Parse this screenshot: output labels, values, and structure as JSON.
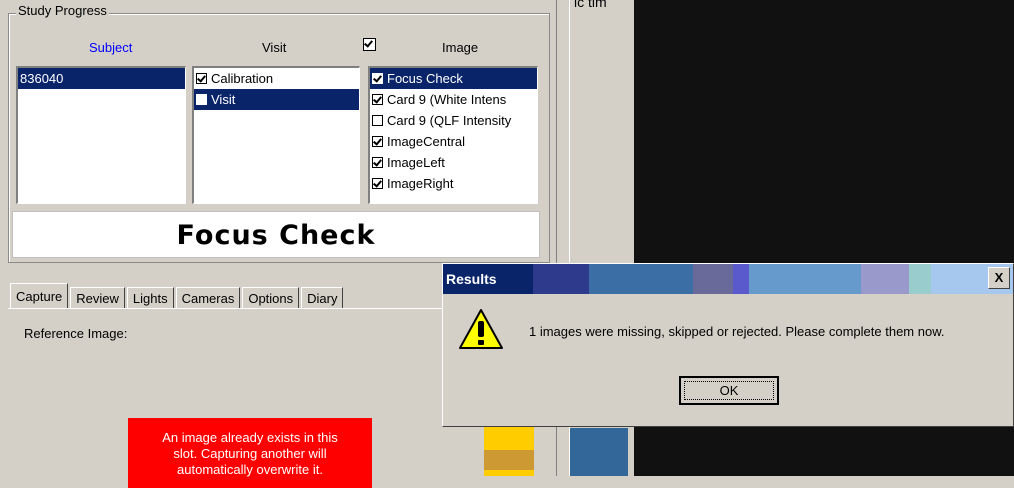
{
  "study_progress": {
    "title": "Study Progress",
    "headers": {
      "subject": "Subject",
      "visit": "Visit",
      "image": "Image"
    },
    "header_checkbox_checked": true,
    "subjects": [
      {
        "label": "836040",
        "selected": true
      }
    ],
    "visits": [
      {
        "label": "Calibration",
        "checked": true,
        "selected": false
      },
      {
        "label": "Visit",
        "checked": false,
        "selected": true
      }
    ],
    "images": [
      {
        "label": "Focus Check",
        "checked": true,
        "selected": true
      },
      {
        "label": "Card 9 (White Intens",
        "checked": true,
        "selected": false
      },
      {
        "label": "Card 9 (QLF Intensity",
        "checked": false,
        "selected": false
      },
      {
        "label": "ImageCentral",
        "checked": true,
        "selected": false
      },
      {
        "label": "ImageLeft",
        "checked": true,
        "selected": false
      },
      {
        "label": "ImageRight",
        "checked": true,
        "selected": false
      }
    ],
    "current_image_title": "Focus Check"
  },
  "tabs": [
    {
      "label": "Capture",
      "active": true
    },
    {
      "label": "Review",
      "active": false
    },
    {
      "label": "Lights",
      "active": false
    },
    {
      "label": "Cameras",
      "active": false
    },
    {
      "label": "Options",
      "active": false
    },
    {
      "label": "Diary",
      "active": false
    }
  ],
  "capture_panel": {
    "reference_label": "Reference Image:",
    "warning": [
      "An image already exists in this",
      "slot. Capturing another will",
      "automatically overwrite it."
    ],
    "warning_color": "#ff0000"
  },
  "right_pane": {
    "clipped_text": "ic tim"
  },
  "dialog": {
    "title": "Results",
    "close_label": "X",
    "icon": "warning-icon",
    "message": "1 images were missing, skipped or rejected. Please complete them now.",
    "ok_label": "OK"
  },
  "colors": {
    "selection": "#0a246a",
    "title_bar": "#0a246a",
    "face": "#d4d0c8"
  }
}
